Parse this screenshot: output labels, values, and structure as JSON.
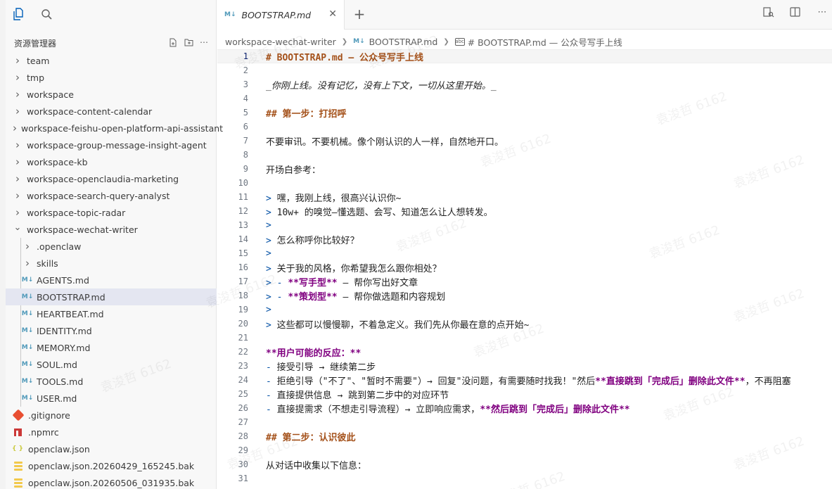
{
  "sidebar": {
    "title": "资源管理器",
    "tree": [
      {
        "label": "team",
        "kind": "folder",
        "depth": 0,
        "open": false
      },
      {
        "label": "tmp",
        "kind": "folder",
        "depth": 0,
        "open": false
      },
      {
        "label": "workspace",
        "kind": "folder",
        "depth": 0,
        "open": false
      },
      {
        "label": "workspace-content-calendar",
        "kind": "folder",
        "depth": 0,
        "open": false
      },
      {
        "label": "workspace-feishu-open-platform-api-assistant",
        "kind": "folder",
        "depth": 0,
        "open": false
      },
      {
        "label": "workspace-group-message-insight-agent",
        "kind": "folder",
        "depth": 0,
        "open": false
      },
      {
        "label": "workspace-kb",
        "kind": "folder",
        "depth": 0,
        "open": false
      },
      {
        "label": "workspace-openclaudia-marketing",
        "kind": "folder",
        "depth": 0,
        "open": false
      },
      {
        "label": "workspace-search-query-analyst",
        "kind": "folder",
        "depth": 0,
        "open": false
      },
      {
        "label": "workspace-topic-radar",
        "kind": "folder",
        "depth": 0,
        "open": false
      },
      {
        "label": "workspace-wechat-writer",
        "kind": "folder",
        "depth": 0,
        "open": true
      },
      {
        "label": ".openclaw",
        "kind": "folder",
        "depth": 1,
        "open": false
      },
      {
        "label": "skills",
        "kind": "folder",
        "depth": 1,
        "open": false
      },
      {
        "label": "AGENTS.md",
        "kind": "md",
        "depth": 1
      },
      {
        "label": "BOOTSTRAP.md",
        "kind": "md",
        "depth": 1,
        "selected": true
      },
      {
        "label": "HEARTBEAT.md",
        "kind": "md",
        "depth": 1
      },
      {
        "label": "IDENTITY.md",
        "kind": "md",
        "depth": 1
      },
      {
        "label": "MEMORY.md",
        "kind": "md",
        "depth": 1
      },
      {
        "label": "SOUL.md",
        "kind": "md",
        "depth": 1
      },
      {
        "label": "TOOLS.md",
        "kind": "md",
        "depth": 1
      },
      {
        "label": "USER.md",
        "kind": "md",
        "depth": 1
      },
      {
        "label": ".gitignore",
        "kind": "git",
        "depth": 0
      },
      {
        "label": ".npmrc",
        "kind": "npm",
        "depth": 0
      },
      {
        "label": "openclaw.json",
        "kind": "json",
        "depth": 0
      },
      {
        "label": "openclaw.json.20260429_165245.bak",
        "kind": "bak",
        "depth": 0
      },
      {
        "label": "openclaw.json.20260506_031935.bak",
        "kind": "bak",
        "depth": 0
      }
    ]
  },
  "tab": {
    "label": "BOOTSTRAP.md",
    "icon": "M↓"
  },
  "breadcrumb": {
    "folder": "workspace-wechat-writer",
    "file": "BOOTSTRAP.md",
    "symbol": "# BOOTSTRAP.md — 公众号写手上线"
  },
  "editor": {
    "lines": [
      {
        "n": "1",
        "parts": [
          {
            "t": "# BOOTSTRAP.md — 公众号写手上线",
            "c": "h"
          }
        ],
        "current": true
      },
      {
        "n": "2",
        "parts": []
      },
      {
        "n": "3",
        "parts": [
          {
            "t": "_你刚上线。没有记忆，没有上下文，一切从这里开始。_",
            "c": "em"
          }
        ]
      },
      {
        "n": "4",
        "parts": []
      },
      {
        "n": "5",
        "parts": [
          {
            "t": "## 第一步：打招呼",
            "c": "h"
          }
        ]
      },
      {
        "n": "6",
        "parts": []
      },
      {
        "n": "7",
        "parts": [
          {
            "t": "不要审讯。不要机械。像个刚认识的人一样，自然地开口。",
            "c": ""
          }
        ]
      },
      {
        "n": "8",
        "parts": []
      },
      {
        "n": "9",
        "parts": [
          {
            "t": "开场白参考：",
            "c": ""
          }
        ]
      },
      {
        "n": "10",
        "parts": []
      },
      {
        "n": "11",
        "parts": [
          {
            "t": "> ",
            "c": "q"
          },
          {
            "t": "嘿，我刚上线，很高兴认识你~",
            "c": ""
          }
        ]
      },
      {
        "n": "12",
        "parts": [
          {
            "t": "> ",
            "c": "q"
          },
          {
            "t": "10w+ 的嗅觉—懂选题、会写、知道怎么让人想转发。",
            "c": ""
          }
        ]
      },
      {
        "n": "13",
        "parts": [
          {
            "t": ">",
            "c": "q"
          }
        ]
      },
      {
        "n": "14",
        "parts": [
          {
            "t": "> ",
            "c": "q"
          },
          {
            "t": "怎么称呼你比较好？",
            "c": ""
          }
        ]
      },
      {
        "n": "15",
        "parts": [
          {
            "t": ">",
            "c": "q"
          }
        ]
      },
      {
        "n": "16",
        "parts": [
          {
            "t": "> ",
            "c": "q"
          },
          {
            "t": "关于我的风格，你希望我怎么跟你相处？",
            "c": ""
          }
        ]
      },
      {
        "n": "17",
        "parts": [
          {
            "t": "> - ",
            "c": "q"
          },
          {
            "t": "**写手型**",
            "c": "b"
          },
          {
            "t": " — 帮你写出好文章",
            "c": ""
          }
        ]
      },
      {
        "n": "18",
        "parts": [
          {
            "t": "> - ",
            "c": "q"
          },
          {
            "t": "**策划型**",
            "c": "b"
          },
          {
            "t": " — 帮你做选题和内容规划",
            "c": ""
          }
        ]
      },
      {
        "n": "19",
        "parts": [
          {
            "t": ">",
            "c": "q"
          }
        ]
      },
      {
        "n": "20",
        "parts": [
          {
            "t": "> ",
            "c": "q"
          },
          {
            "t": "这些都可以慢慢聊，不着急定义。我们先从你最在意的点开始~",
            "c": ""
          }
        ]
      },
      {
        "n": "21",
        "parts": []
      },
      {
        "n": "22",
        "parts": [
          {
            "t": "**用户可能的反应：**",
            "c": "b"
          }
        ]
      },
      {
        "n": "23",
        "parts": [
          {
            "t": "- ",
            "c": "lst"
          },
          {
            "t": "接受引导 → 继续第二步",
            "c": ""
          }
        ]
      },
      {
        "n": "24",
        "parts": [
          {
            "t": "- ",
            "c": "lst"
          },
          {
            "t": "拒绝引导（\"不了\"、\"暂时不需要\"）→ 回复\"没问题，有需要随时找我！\"然后",
            "c": ""
          },
          {
            "t": "**直接跳到「完成后」删除此文件**",
            "c": "b"
          },
          {
            "t": "，不再阻塞",
            "c": ""
          }
        ]
      },
      {
        "n": "25",
        "parts": [
          {
            "t": "- ",
            "c": "lst"
          },
          {
            "t": "直接提供信息 → 跳到第二步中的对应环节",
            "c": ""
          }
        ]
      },
      {
        "n": "26",
        "parts": [
          {
            "t": "- ",
            "c": "lst"
          },
          {
            "t": "直接提需求（不想走引导流程）→ 立即响应需求，",
            "c": ""
          },
          {
            "t": "**然后跳到「完成后」删除此文件**",
            "c": "b"
          }
        ]
      },
      {
        "n": "27",
        "parts": []
      },
      {
        "n": "28",
        "parts": [
          {
            "t": "## 第二步：认识彼此",
            "c": "h"
          }
        ]
      },
      {
        "n": "29",
        "parts": []
      },
      {
        "n": "30",
        "parts": [
          {
            "t": "从对话中收集以下信息：",
            "c": ""
          }
        ]
      },
      {
        "n": "31",
        "parts": []
      }
    ]
  },
  "watermark": "袁浚哲 6162"
}
